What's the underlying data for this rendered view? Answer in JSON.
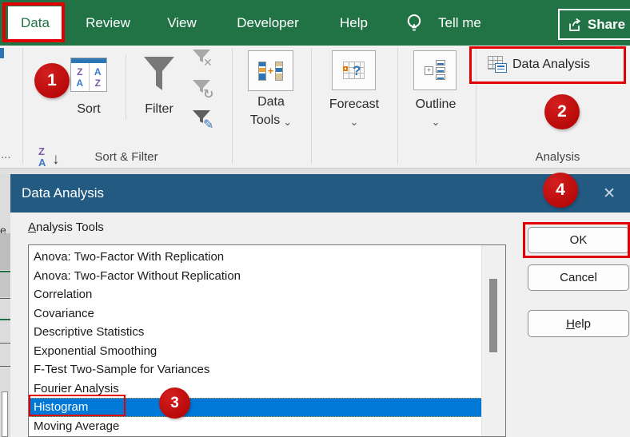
{
  "tab_bar": {
    "tabs": [
      {
        "label": "Data"
      },
      {
        "label": "Review"
      },
      {
        "label": "View"
      },
      {
        "label": "Developer"
      },
      {
        "label": "Help"
      }
    ],
    "tell_me": "Tell me",
    "share_label": "Share"
  },
  "ribbon": {
    "sort_label": "Sort",
    "filter_label": "Filter",
    "data_tools_line1": "Data",
    "data_tools_line2": "Tools",
    "forecast_label": "Forecast",
    "outline_label": "Outline",
    "data_analysis_label": "Data Analysis",
    "group_sort_filter": "Sort & Filter",
    "group_analysis": "Analysis",
    "overflow": "..."
  },
  "dialog": {
    "title": "Data Analysis",
    "tools_label_mnemonic": "A",
    "tools_label_rest": "nalysis Tools",
    "tools": [
      "Anova: Two-Factor With Replication",
      "Anova: Two-Factor Without Replication",
      "Correlation",
      "Covariance",
      "Descriptive Statistics",
      "Exponential Smoothing",
      "F-Test Two-Sample for Variances",
      "Fourier Analysis",
      "Histogram",
      "Moving Average"
    ],
    "selected_tool": "Histogram",
    "ok_label": "OK",
    "cancel_label": "Cancel",
    "help_label_mnemonic": "H",
    "help_label_rest": "elp"
  },
  "annotations": {
    "step_1": "1",
    "step_2": "2",
    "step_3": "3",
    "step_4": "4"
  },
  "icons": {
    "chevron_down": "⌄",
    "close": "✕",
    "clear_filter_x": "✕",
    "reapply_refresh": "↻",
    "advanced_pencil": "✎",
    "sort_small_z": "Z",
    "sort_small_a": "A",
    "sort_small_arrow": "↓",
    "sort_grid_za": "ZA",
    "sort_grid_az": "AZ",
    "outline_plus": "+",
    "forecast_question": "?",
    "data_tools_plus": "+"
  },
  "colors": {
    "excel_green": "#217346",
    "dialog_title_bar": "#235A82",
    "selection_blue": "#0078D7",
    "annotation_red": "#C00000",
    "highlight_red": "#E20000"
  }
}
